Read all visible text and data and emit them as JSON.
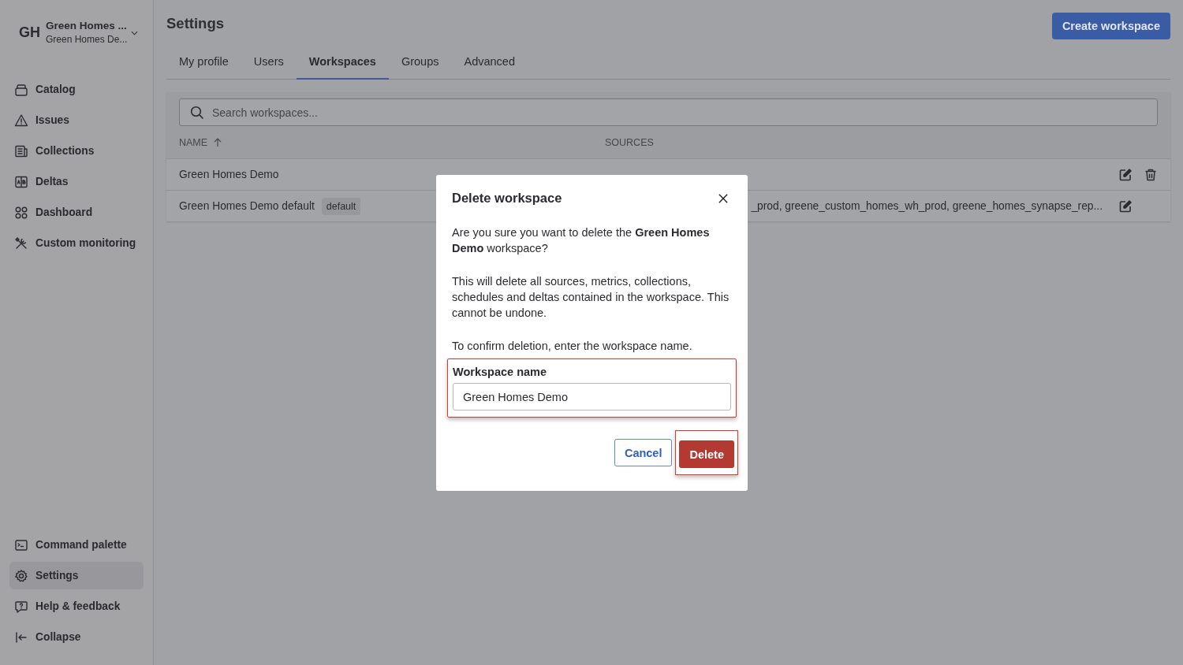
{
  "sidebar": {
    "avatar": "GH",
    "org_name": "Green Homes ...",
    "workspace_name": "Green Homes De...",
    "nav_items": [
      {
        "label": "Catalog",
        "selected": false
      },
      {
        "label": "Issues",
        "selected": false
      },
      {
        "label": "Collections",
        "selected": false
      },
      {
        "label": "Deltas",
        "selected": false
      },
      {
        "label": "Dashboard",
        "selected": false
      },
      {
        "label": "Custom monitoring",
        "selected": false
      }
    ],
    "footer_items": [
      {
        "label": "Command palette",
        "selected": false
      },
      {
        "label": "Settings",
        "selected": true
      },
      {
        "label": "Help & feedback",
        "selected": false
      },
      {
        "label": "Collapse",
        "selected": false
      }
    ]
  },
  "header": {
    "title": "Settings",
    "create_button": "Create workspace"
  },
  "tabs": [
    {
      "label": "My profile",
      "selected": false
    },
    {
      "label": "Users",
      "selected": false
    },
    {
      "label": "Workspaces",
      "selected": true
    },
    {
      "label": "Groups",
      "selected": false
    },
    {
      "label": "Advanced",
      "selected": false
    }
  ],
  "search": {
    "placeholder": "Search workspaces..."
  },
  "table": {
    "columns": [
      {
        "label": "NAME",
        "sorted": true
      },
      {
        "label": "SOURCES",
        "sorted": false
      }
    ],
    "rows": [
      {
        "name": "Green Homes Demo",
        "deletable": true
      },
      {
        "name": "Green Homes Demo default",
        "badge": "default",
        "sources": "_prod, greene_custom_homes_wh_prod, greene_homes_synapse_rep...",
        "deletable": false
      }
    ]
  },
  "dialog": {
    "title": "Delete workspace",
    "question": "Are you sure you want to delete the **Green Homes Demo** workspace?",
    "warning": "This will delete all sources, metrics, collections, schedules and deltas contained in the workspace. This cannot be undone.",
    "instruction": "To confirm deletion, enter the workspace name.",
    "field": {
      "label": "Workspace name",
      "value": "Green Homes Demo",
      "highlighted": true
    },
    "cancel_button": "Cancel",
    "delete_button": {
      "label": "Delete",
      "highlighted": true
    }
  }
}
